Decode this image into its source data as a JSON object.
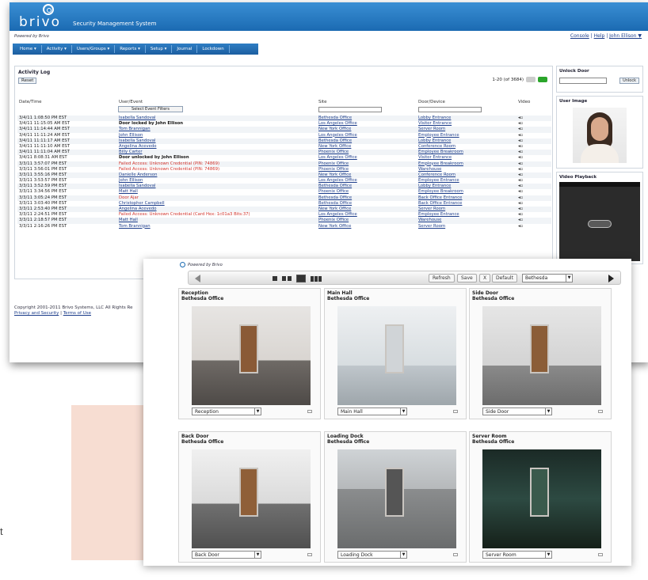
{
  "app": {
    "logo_text": "brivo",
    "product_name": "Security Management System",
    "powered_by": "Powered by Brivo",
    "top_links": [
      "Console",
      "Help",
      "John Ellison ▼"
    ]
  },
  "nav": [
    "Home ▾",
    "Activity ▾",
    "Users/Groups ▾",
    "Reports ▾",
    "Setup ▾",
    "Journal",
    "Lockdown"
  ],
  "activity_log": {
    "title": "Activity Log",
    "reset_label": "Reset",
    "pager_text": "1-20 (of 3684)",
    "filter_button": "Select Event Filters",
    "columns": [
      "Date/Time",
      "User/Event",
      "Site",
      "Door/Device",
      "Video"
    ],
    "rows": [
      {
        "time": "3/4/11 1:08:50 PM EST",
        "event": "Isabella Sandoval",
        "type": "link",
        "site": "Bethesda Office",
        "door": "Lobby Entrance"
      },
      {
        "time": "3/4/11 11:15:05 AM EST",
        "event": "Door locked by John Ellison",
        "type": "plain",
        "site": "Los Angeles Office",
        "door": "Visitor Entrance"
      },
      {
        "time": "3/4/11 11:14:44 AM EST",
        "event": "Tom Brannigan",
        "type": "link",
        "site": "New York Office",
        "door": "Server Room"
      },
      {
        "time": "3/4/11 11:11:24 AM EST",
        "event": "John Ellison",
        "type": "link",
        "site": "Los Angeles Office",
        "door": "Employee Entrance"
      },
      {
        "time": "3/4/11 11:11:17 AM EST",
        "event": "Isabella Sandoval",
        "type": "link",
        "site": "Bethesda Office",
        "door": "Lobby Entrance"
      },
      {
        "time": "3/4/11 11:11:10 AM EST",
        "event": "Angelina Acevedo",
        "type": "link",
        "site": "New York Office",
        "door": "Conference Room"
      },
      {
        "time": "3/4/11 11:11:04 AM EST",
        "event": "Billy Carter",
        "type": "link",
        "site": "Phoenix Office",
        "door": "Employee Breakroom"
      },
      {
        "time": "3/4/11 8:08:31 AM EST",
        "event": "Door unlocked by John Ellison",
        "type": "plain",
        "site": "Los Angeles Office",
        "door": "Visitor Entrance"
      },
      {
        "time": "3/3/11 3:57:07 PM EST",
        "event": "Failed Access: Unknown Credential (PIN: 74869)",
        "type": "alert",
        "site": "Phoenix Office",
        "door": "Employee Breakroom"
      },
      {
        "time": "3/3/11 3:56:01 PM EST",
        "event": "Failed Access: Unknown Credential (PIN: 74869)",
        "type": "alert",
        "site": "Phoenix Office",
        "door": "Warehouse"
      },
      {
        "time": "3/3/11 3:55:16 PM EST",
        "event": "Danielle Anderson",
        "type": "link",
        "site": "New York Office",
        "door": "Conference Room"
      },
      {
        "time": "3/3/11 3:53:57 PM EST",
        "event": "John Ellison",
        "type": "link",
        "site": "Los Angeles Office",
        "door": "Employee Entrance"
      },
      {
        "time": "3/3/11 3:52:59 PM EST",
        "event": "Isabella Sandoval",
        "type": "link",
        "site": "Bethesda Office",
        "door": "Lobby Entrance"
      },
      {
        "time": "3/3/11 3:34:56 PM EST",
        "event": "Matt Hall",
        "type": "link",
        "site": "Phoenix Office",
        "door": "Employee Breakroom"
      },
      {
        "time": "3/3/11 3:05:24 PM EST",
        "event": "Door Ajar",
        "type": "alert",
        "site": "Bethesda Office",
        "door": "Back Office Entrance"
      },
      {
        "time": "3/3/11 3:03:40 PM EST",
        "event": "Christopher Campbell",
        "type": "link",
        "site": "Bethesda Office",
        "door": "Back Office Entrance"
      },
      {
        "time": "3/3/11 2:53:40 PM EST",
        "event": "Angelina Acevedo",
        "type": "link",
        "site": "New York Office",
        "door": "Server Room"
      },
      {
        "time": "3/3/11 2:24:51 PM EST",
        "event": "Failed Access: Unknown Credential (Card Hex: 1c01a3 Bits:37)",
        "type": "alert",
        "site": "Los Angeles Office",
        "door": "Employee Entrance"
      },
      {
        "time": "3/3/11 2:18:57 PM EST",
        "event": "Matt Hall",
        "type": "link",
        "site": "Phoenix Office",
        "door": "Warehouse"
      },
      {
        "time": "3/3/11 2:16:26 PM EST",
        "event": "Tom Brannigan",
        "type": "link",
        "site": "New York Office",
        "door": "Server Room"
      }
    ]
  },
  "side_panels": {
    "unlock_title": "Unlock Door",
    "unlock_button": "Unlock",
    "user_image_title": "User Image",
    "video_playback_title": "Video Playback"
  },
  "footer": {
    "copyright": "Copyright 2001-2011 Brivo Systems, LLC All Rights Re",
    "privacy": "Privacy and Security",
    "terms": "Terms of Use"
  },
  "camera_view": {
    "powered_by": "Powered by Brivo",
    "refresh": "Refresh",
    "save": "Save",
    "x": "X",
    "default": "Default",
    "site_select": "Bethesda",
    "cameras": [
      {
        "name": "Reception",
        "location": "Bethesda Office",
        "select": "Reception"
      },
      {
        "name": "Main Hall",
        "location": "Bethesda Office",
        "select": "Main Hall"
      },
      {
        "name": "Side Door",
        "location": "Bethesda Office",
        "select": "Side Door"
      },
      {
        "name": "Back Door",
        "location": "Bethesda Office",
        "select": "Back Door"
      },
      {
        "name": "Loading Dock",
        "location": "Bethesda Office",
        "select": "Loading Dock"
      },
      {
        "name": "Server Room",
        "location": "Bethesda Office",
        "select": "Server Room"
      }
    ]
  },
  "stray_text": "t",
  "colors": {
    "brand_blue": "#1b6ab2",
    "link": "#1b3c8a",
    "alert": "#d2332b"
  }
}
